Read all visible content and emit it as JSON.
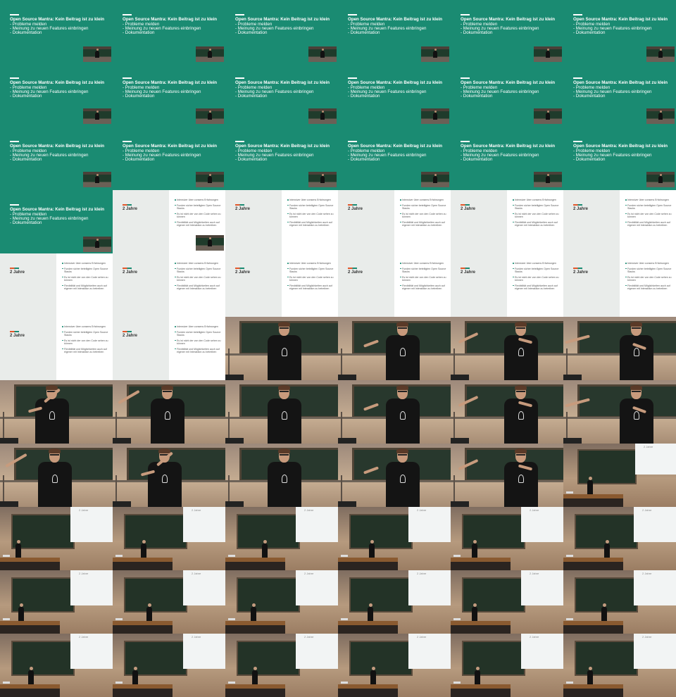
{
  "slide_green": {
    "title": "Open Source Mantra: Kein Beitrag ist zu klein",
    "items": [
      "- Probleme melden",
      "- Meinung zu neuen Features einbringen",
      "- Dokumentation"
    ],
    "color": "#1a8b72"
  },
  "slide_white": {
    "left_title": "2 Jahre",
    "bullets": [
      "Intensiver über consens Erfahrungen",
      "Funden sicher beteiligten Open Source Stacks",
      "Es ist nicht der von den Code sehen zu können",
      "Flexibilität und Möglichkeiten auch auf eigener mit Interaktion zu betreiben"
    ],
    "accent_orange": "#e2562a",
    "accent_green": "#1a8b72"
  },
  "wide_screen_label": "2 Jahre",
  "tiles": [
    "green-inset",
    "green-inset",
    "green-inset",
    "green-inset",
    "green-inset",
    "green-inset",
    "green-inset-low",
    "green-inset-low",
    "green-inset-low",
    "green-inset-low",
    "green-inset-low",
    "green-inset-low",
    "green-inset-low",
    "green-inset-low",
    "green-inset-low",
    "green-inset-low",
    "green-inset-low",
    "green-inset-low",
    "green-inset",
    "slide-inset",
    "slide",
    "slide",
    "slide",
    "slide",
    "slide",
    "slide",
    "slide",
    "slide",
    "slide",
    "slide",
    "slide",
    "slide",
    "close-a",
    "close-b",
    "close-c",
    "close-d",
    "close-e",
    "close-f",
    "close-a",
    "close-b",
    "close-c",
    "close-d",
    "close-f",
    "close-e",
    "close-a",
    "close-b",
    "close-c",
    "wide-lone",
    "wide",
    "wide",
    "wide",
    "wide",
    "wide",
    "wide",
    "wide",
    "wide",
    "wide",
    "wide",
    "wide",
    "wide",
    "wide",
    "wide",
    "wide",
    "wide",
    "wide",
    "wide"
  ]
}
